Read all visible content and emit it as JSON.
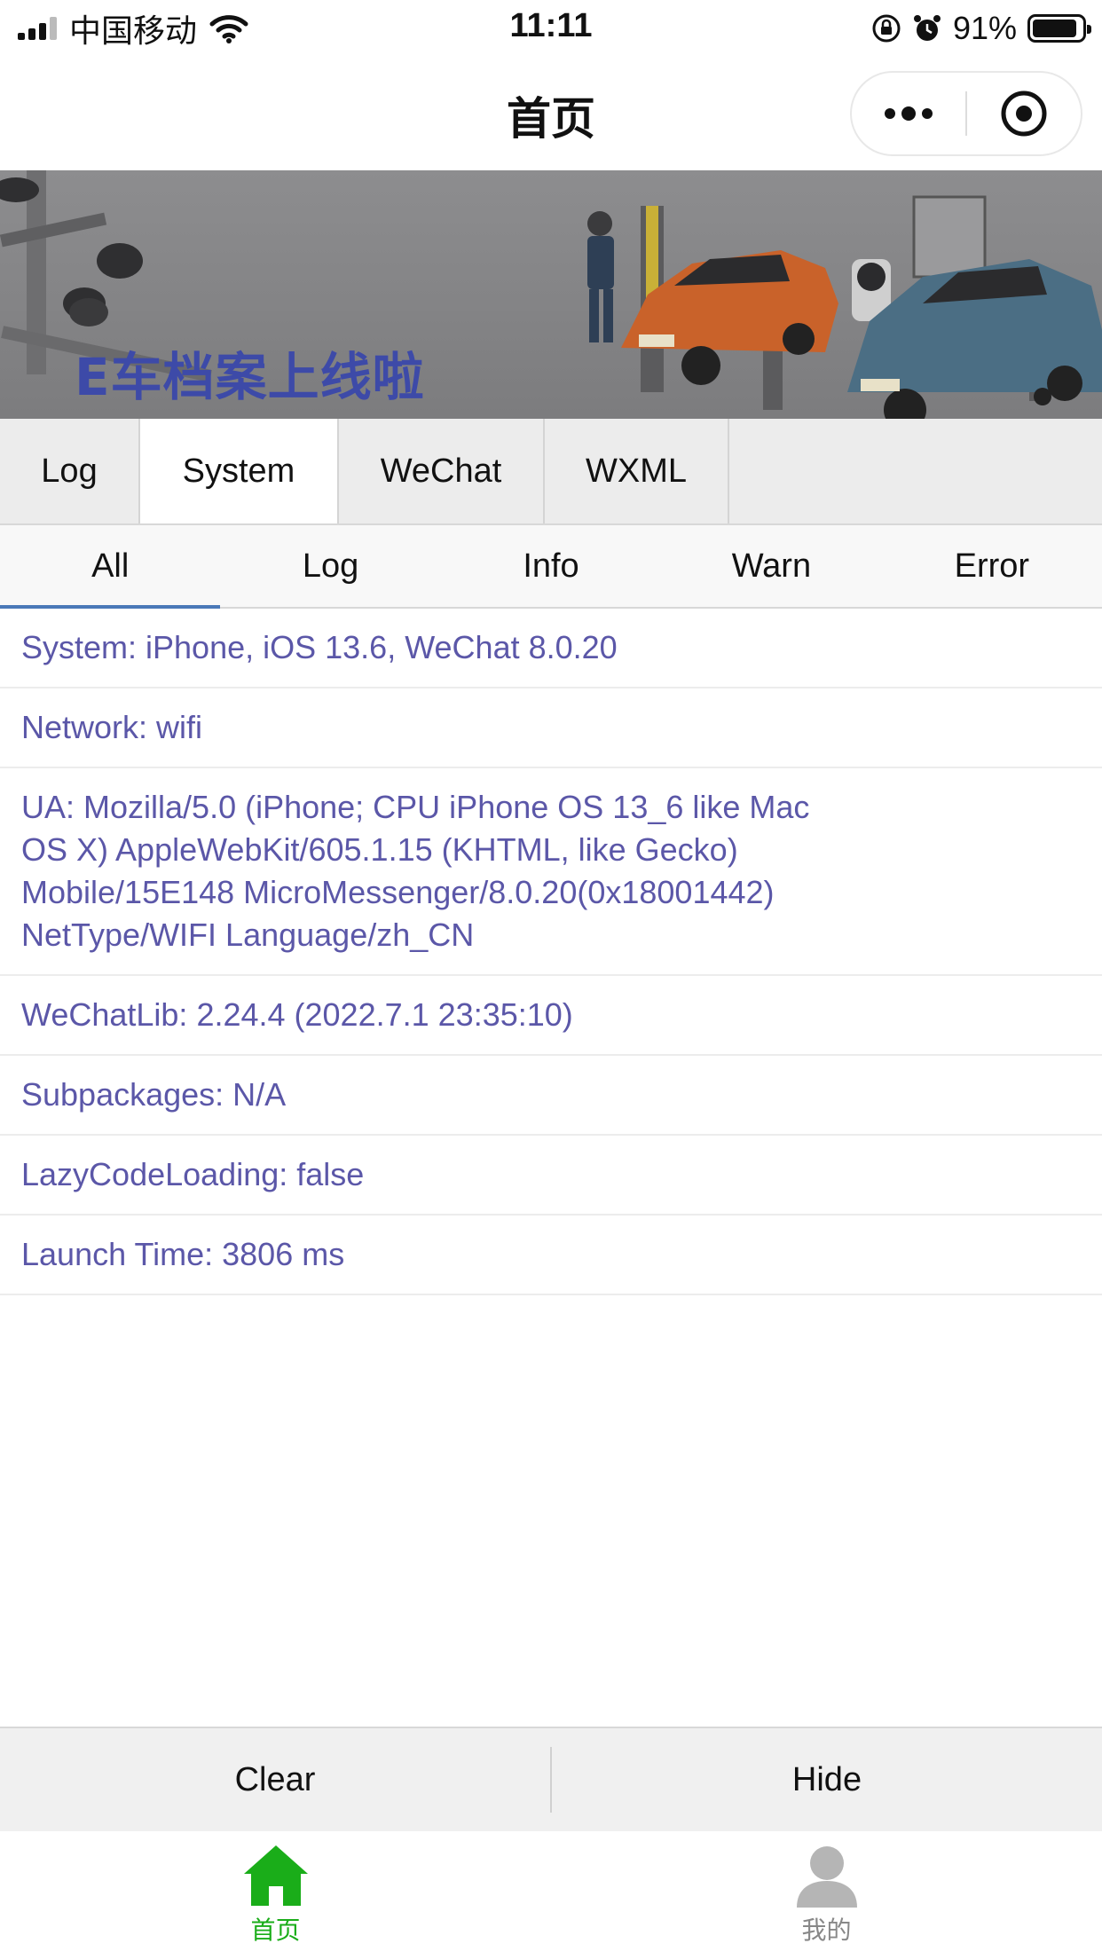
{
  "status_bar": {
    "carrier": "中国移动",
    "time": "11:11",
    "battery": "91%",
    "battery_level": 0.91
  },
  "nav": {
    "title": "首页"
  },
  "banner": {
    "text": "E车档案上线啦"
  },
  "tabs": [
    {
      "label": "Log",
      "active": false
    },
    {
      "label": "System",
      "active": true
    },
    {
      "label": "WeChat",
      "active": false
    },
    {
      "label": "WXML",
      "active": false
    }
  ],
  "subtabs": [
    {
      "label": "All",
      "active": true
    },
    {
      "label": "Log",
      "active": false
    },
    {
      "label": "Info",
      "active": false
    },
    {
      "label": "Warn",
      "active": false
    },
    {
      "label": "Error",
      "active": false
    }
  ],
  "log_rows": [
    [
      "System: iPhone, iOS 13.6, WeChat 8.0.20"
    ],
    [
      "Network: wifi"
    ],
    [
      "UA: Mozilla/5.0 (iPhone; CPU iPhone OS 13_6 like Mac",
      "OS X) AppleWebKit/605.1.15 (KHTML, like Gecko)",
      "Mobile/15E148 MicroMessenger/8.0.20(0x18001442)",
      "NetType/WIFI Language/zh_CN"
    ],
    [
      "WeChatLib: 2.24.4 (2022.7.1 23:35:10)"
    ],
    [
      "Subpackages: N/A"
    ],
    [
      "LazyCodeLoading: false"
    ],
    [
      "Launch Time: 3806 ms"
    ]
  ],
  "actions": {
    "clear": "Clear",
    "hide": "Hide"
  },
  "tabbar": {
    "home": "首页",
    "mine": "我的",
    "active_color": "#1aad19",
    "inactive_color": "#888888"
  },
  "colors": {
    "log_text": "#5b57a8",
    "subtab_indicator": "#4a79b8"
  }
}
